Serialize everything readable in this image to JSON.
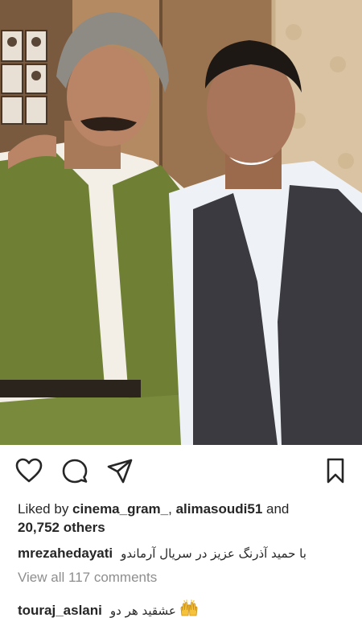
{
  "post": {
    "photo_description": "",
    "likes": {
      "prefix": "Liked by ",
      "user1": "cinema_gram_",
      "separator": ", ",
      "user2": "alimasoudi51",
      "conjunction": " and",
      "others": "20,752 others"
    },
    "caption": {
      "username": "mrezahedayati",
      "text": "با حمید آذرنگ عزیز در سریال آرماندو"
    },
    "view_all_comments": "View all 117 comments",
    "comment": {
      "username": "touraj_aslani",
      "text": "عشقید هر دو",
      "emoji": "raised-hands-emoji"
    },
    "icons": {
      "like": "heart-icon",
      "comment": "comment-bubble-icon",
      "share": "paper-plane-icon",
      "save": "bookmark-icon"
    }
  }
}
